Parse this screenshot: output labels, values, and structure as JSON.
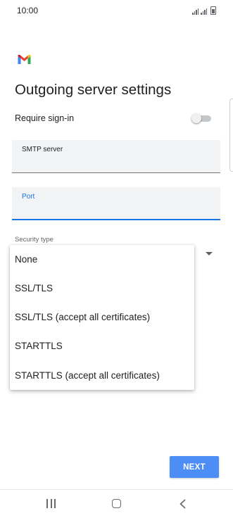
{
  "status_bar": {
    "time": "10:00",
    "icons": [
      "wifi-signal-icon",
      "cell-signal-icon",
      "battery-icon"
    ]
  },
  "app": {
    "logo_icon": "gmail-logo-icon",
    "brand_colors": [
      "#4285f4",
      "#ea4335",
      "#fbbc04",
      "#34a853"
    ]
  },
  "page": {
    "title": "Outgoing server settings"
  },
  "require_signin": {
    "label": "Require sign-in",
    "enabled": false
  },
  "fields": {
    "smtp_server": {
      "label": "SMTP server",
      "value": ""
    },
    "port": {
      "label": "Port",
      "value": "",
      "focused": true
    }
  },
  "security": {
    "label": "Security type",
    "icon": "dropdown-arrow-icon"
  },
  "security_menu": {
    "options": [
      "None",
      "SSL/TLS",
      "SSL/TLS (accept all certificates)",
      "STARTTLS",
      "STARTTLS (accept all certificates)"
    ]
  },
  "actions": {
    "next_label": "NEXT",
    "next_color": "#4d8df6"
  },
  "nav_bar": {
    "icons": [
      "recents-icon",
      "home-icon",
      "back-icon"
    ]
  },
  "colors": {
    "accent": "#1a73e8"
  }
}
